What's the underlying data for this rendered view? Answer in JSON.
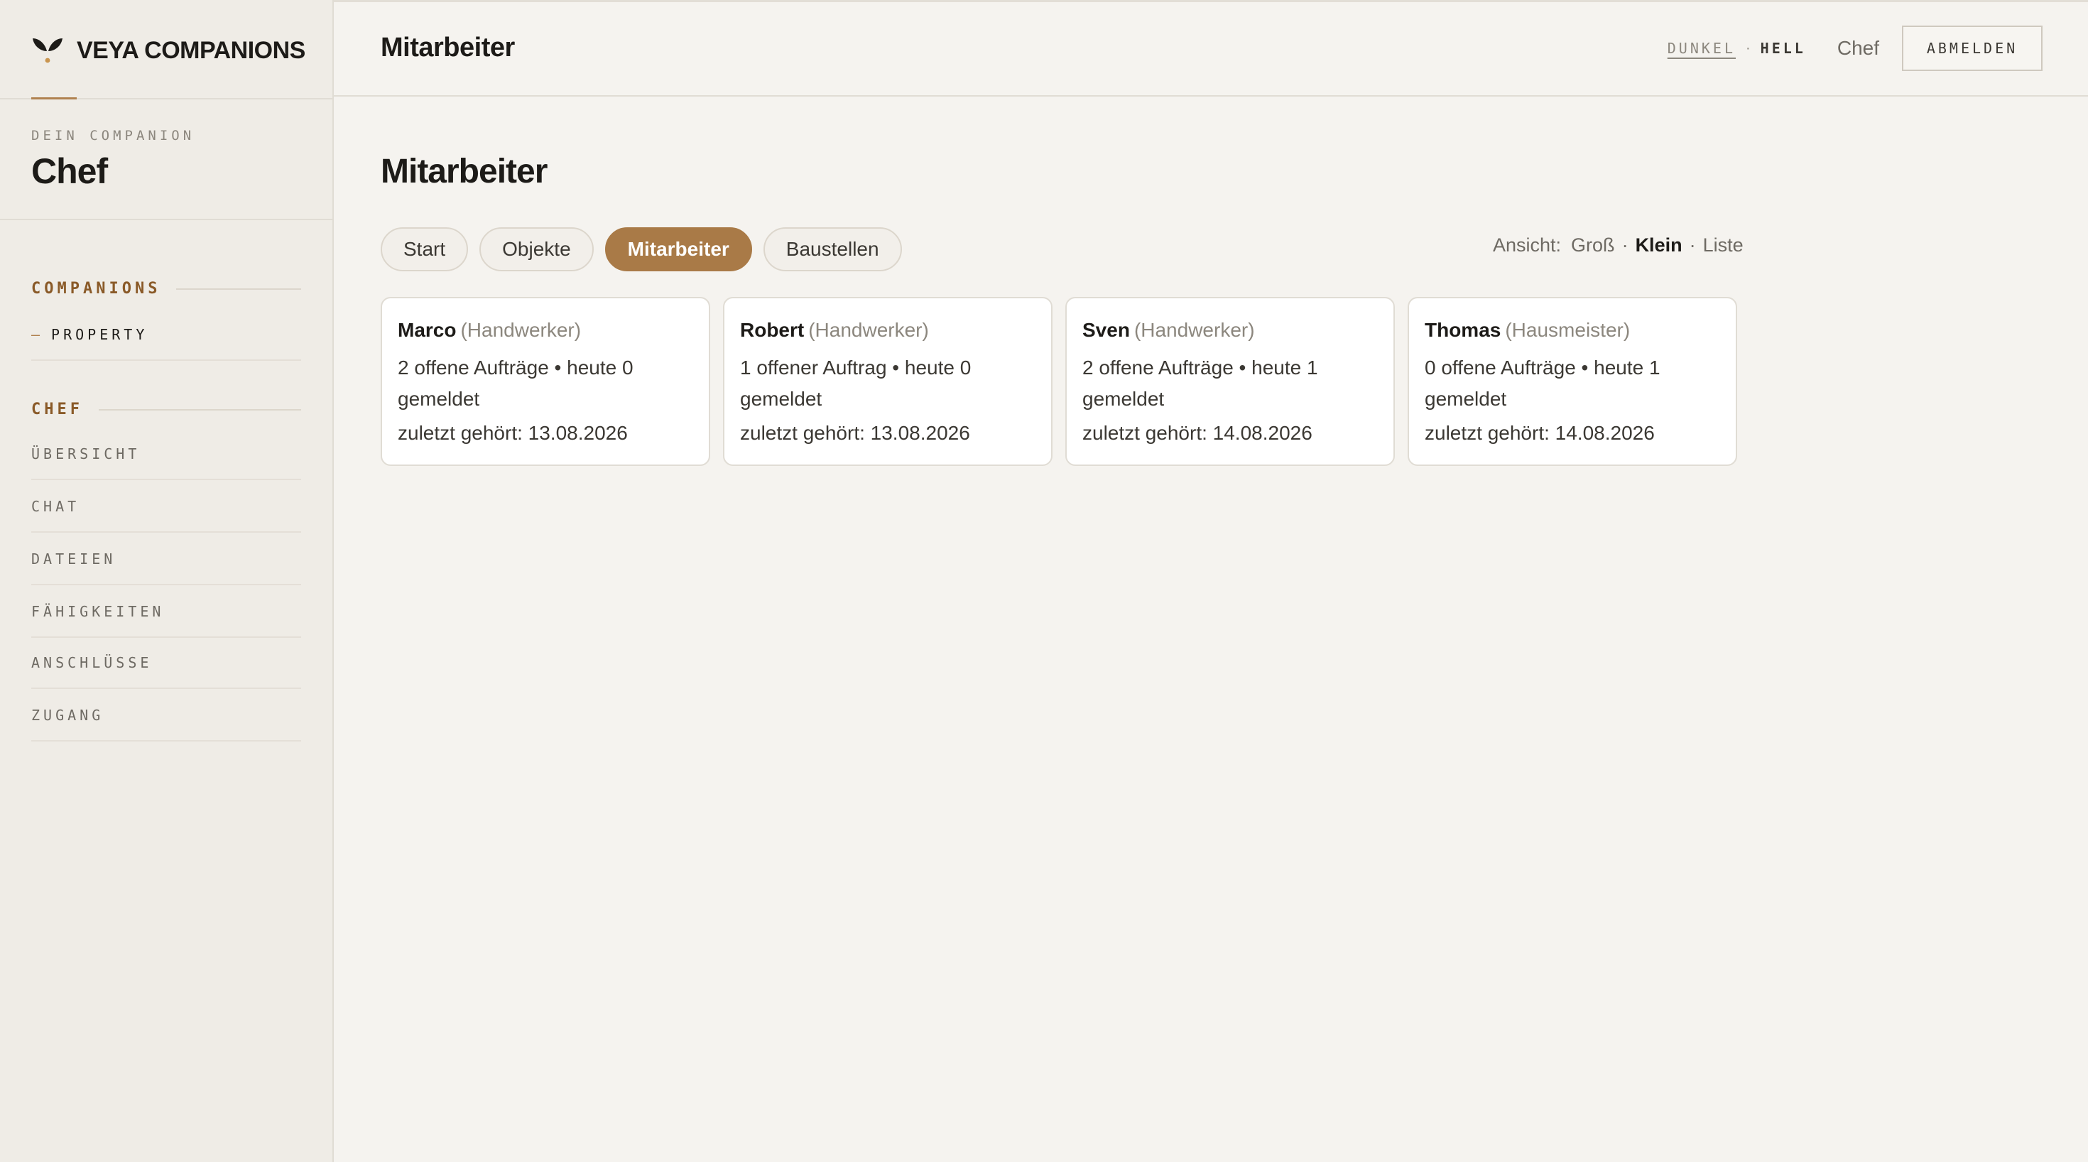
{
  "brand": {
    "name": "VEYA COMPANIONS"
  },
  "sidebar": {
    "companion_label": "DEIN COMPANION",
    "companion_name": "Chef",
    "sections": [
      {
        "title": "COMPANIONS",
        "items": [
          {
            "label": "PROPERTY"
          }
        ]
      },
      {
        "title": "CHEF",
        "items": [
          {
            "label": "ÜBERSICHT"
          },
          {
            "label": "CHAT"
          },
          {
            "label": "DATEIEN"
          },
          {
            "label": "FÄHIGKEITEN"
          },
          {
            "label": "ANSCHLÜSSE"
          },
          {
            "label": "ZUGANG"
          }
        ]
      }
    ]
  },
  "header": {
    "title": "Mitarbeiter",
    "theme_dark": "DUNKEL",
    "theme_separator": "·",
    "theme_light": "HELL",
    "user": "Chef",
    "logout": "ABMELDEN"
  },
  "main": {
    "title": "Mitarbeiter",
    "tabs": [
      {
        "label": "Start",
        "active": false
      },
      {
        "label": "Objekte",
        "active": false
      },
      {
        "label": "Mitarbeiter",
        "active": true
      },
      {
        "label": "Baustellen",
        "active": false
      }
    ],
    "view": {
      "label": "Ansicht:",
      "options": [
        {
          "label": "Groß",
          "active": false
        },
        {
          "label": "Klein",
          "active": true
        },
        {
          "label": "Liste",
          "active": false
        }
      ],
      "separator": "·"
    },
    "employees": [
      {
        "name": "Marco",
        "role": "(Handwerker)",
        "summary": "2 offene Aufträge • heute 0 gemeldet",
        "last_heard": "zuletzt gehört: 13.08.2026"
      },
      {
        "name": "Robert",
        "role": "(Handwerker)",
        "summary": "1 offener Auftrag • heute 0 gemeldet",
        "last_heard": "zuletzt gehört: 13.08.2026"
      },
      {
        "name": "Sven",
        "role": "(Handwerker)",
        "summary": "2 offene Aufträge • heute 1 gemeldet",
        "last_heard": "zuletzt gehört: 14.08.2026"
      },
      {
        "name": "Thomas",
        "role": "(Hausmeister)",
        "summary": "0 offene Aufträge • heute 1 gemeldet",
        "last_heard": "zuletzt gehört: 14.08.2026"
      }
    ]
  },
  "colors": {
    "accent": "#a97a47",
    "section_title": "#8a5a28",
    "background": "#f5f3ef",
    "sidebar": "#efece6"
  },
  "icons": {
    "logo": "veya-leaf-icon"
  }
}
